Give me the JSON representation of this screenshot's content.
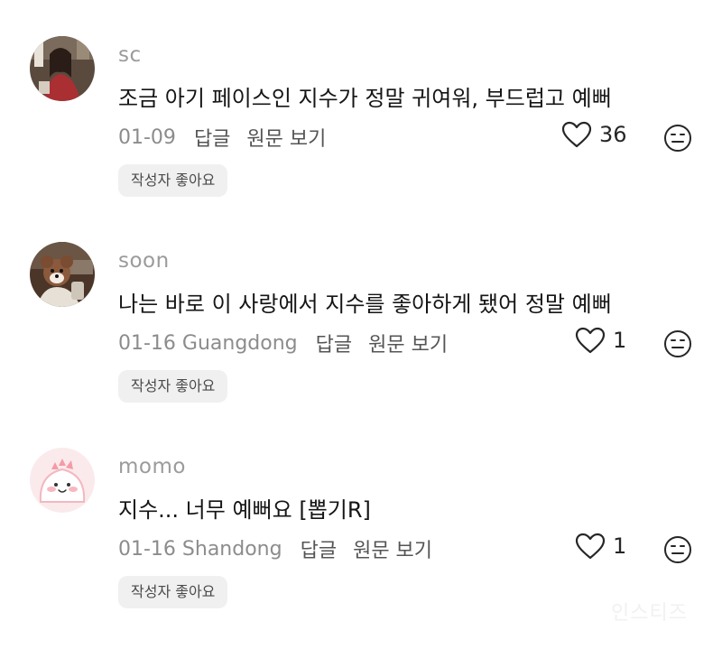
{
  "comments": [
    {
      "username": "sc",
      "text": "조금 아기 페이스인 지수가 정말 귀여워, 부드럽고 예뻐",
      "date": "01-09",
      "reply_label": "답글",
      "original_label": "원문 보기",
      "likes": "36",
      "badge": "작성자 좋아요",
      "avatar_icon": "photo-avatar-woman",
      "like_icon": "heart-outline-icon",
      "dislike_icon": "meh-face-icon"
    },
    {
      "username": "soon",
      "text": "나는 바로 이 사랑에서 지수를 좋아하게 됐어 정말 예뻐",
      "date": "01-16 Guangdong",
      "reply_label": "답글",
      "original_label": "원문 보기",
      "likes": "1",
      "badge": "작성자 좋아요",
      "avatar_icon": "photo-avatar-puppy",
      "like_icon": "heart-outline-icon",
      "dislike_icon": "meh-face-icon"
    },
    {
      "username": "momo",
      "text": "지수... 너무 예뻐요 [뽑기R]",
      "date": "01-16 Shandong",
      "reply_label": "답글",
      "original_label": "원문 보기",
      "likes": "1",
      "badge": "작성자 좋아요",
      "avatar_icon": "cartoon-avatar-pink-dino",
      "like_icon": "heart-outline-icon",
      "dislike_icon": "meh-face-icon"
    }
  ],
  "watermark": "인스티즈",
  "colors": {
    "username": "#9b9b9b",
    "text": "#151515",
    "meta": "#8c8c8c",
    "badge_bg": "#f0f0f0"
  }
}
